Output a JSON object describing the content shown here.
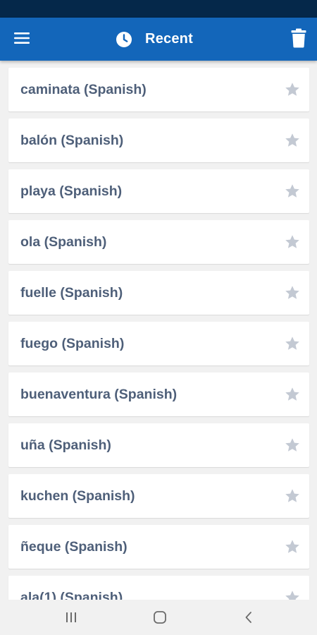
{
  "header": {
    "title": "Recent",
    "menu_icon": "hamburger-menu-icon",
    "title_icon": "clock-icon",
    "action_icon": "trash-icon",
    "background": "#1366ba",
    "status_bar_color": "#05284a"
  },
  "recent_words": [
    {
      "label": "caminata (Spanish)"
    },
    {
      "label": "balón (Spanish)"
    },
    {
      "label": "playa (Spanish)"
    },
    {
      "label": "ola (Spanish)"
    },
    {
      "label": "fuelle (Spanish)"
    },
    {
      "label": "fuego (Spanish)"
    },
    {
      "label": "buenaventura (Spanish)"
    },
    {
      "label": "uña (Spanish)"
    },
    {
      "label": "kuchen (Spanish)"
    },
    {
      "label": "ñeque (Spanish)"
    },
    {
      "label": "ala(1) (Spanish)"
    }
  ],
  "item_icon": "star-icon",
  "nav": {
    "recents_icon": "recent-apps-icon",
    "home_icon": "home-icon",
    "back_icon": "back-icon"
  }
}
